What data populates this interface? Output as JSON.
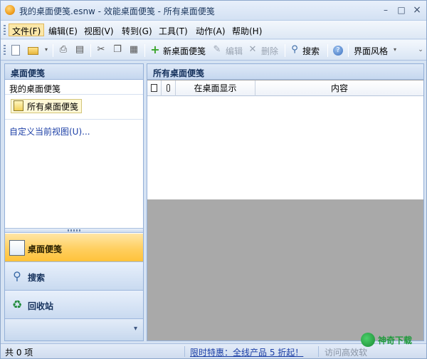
{
  "window": {
    "title": "我的桌面便笺.esnw - 效能桌面便笺 - 所有桌面便笺",
    "min_glyph": "–",
    "max_glyph": "□",
    "close_glyph": "×"
  },
  "menu": {
    "items": [
      "文件(F)",
      "编辑(E)",
      "视图(V)",
      "转到(G)",
      "工具(T)",
      "动作(A)",
      "帮助(H)"
    ],
    "active_index": 0
  },
  "toolbar": {
    "new_note_label": "新桌面便笺",
    "edit_label": "编辑",
    "delete_label": "删除",
    "search_label": "搜索",
    "style_label": "界面风格",
    "dropdown_glyph": "▾",
    "overflow_glyph": "⌄",
    "icons": [
      "new-document-icon",
      "open-folder-icon",
      "print-icon",
      "print-preview-icon",
      "cut-icon",
      "copy-icon",
      "paste-icon",
      "plus-icon",
      "edit-icon",
      "delete-icon",
      "search-icon",
      "help-icon"
    ]
  },
  "left_panel": {
    "header": "桌面便笺",
    "group_label": "我的桌面便笺",
    "selected_folder": "所有桌面便笺",
    "customize_link": "自定义当前视图(U)...",
    "nav": {
      "notes": "桌面便笺",
      "search": "搜索",
      "recycle": "回收站",
      "selected": "notes"
    },
    "footer_arrow": "▾"
  },
  "right_panel": {
    "header": "所有桌面便笺",
    "columns": [
      "",
      "",
      "在桌面显示",
      "内容"
    ],
    "rows": [],
    "scroll_left_glyph": "◀",
    "scroll_right_glyph": "▶"
  },
  "status": {
    "count": "共 0 项",
    "promo": "限时特惠：全线产品 5 折起！",
    "visit": "访问高效软"
  },
  "watermark": {
    "text": "神奇下载"
  },
  "colors": {
    "accent_selected": "#ffc23b",
    "header_text": "#15315c",
    "link": "#1c3fa6",
    "preview_gray": "#a9a9a9"
  }
}
